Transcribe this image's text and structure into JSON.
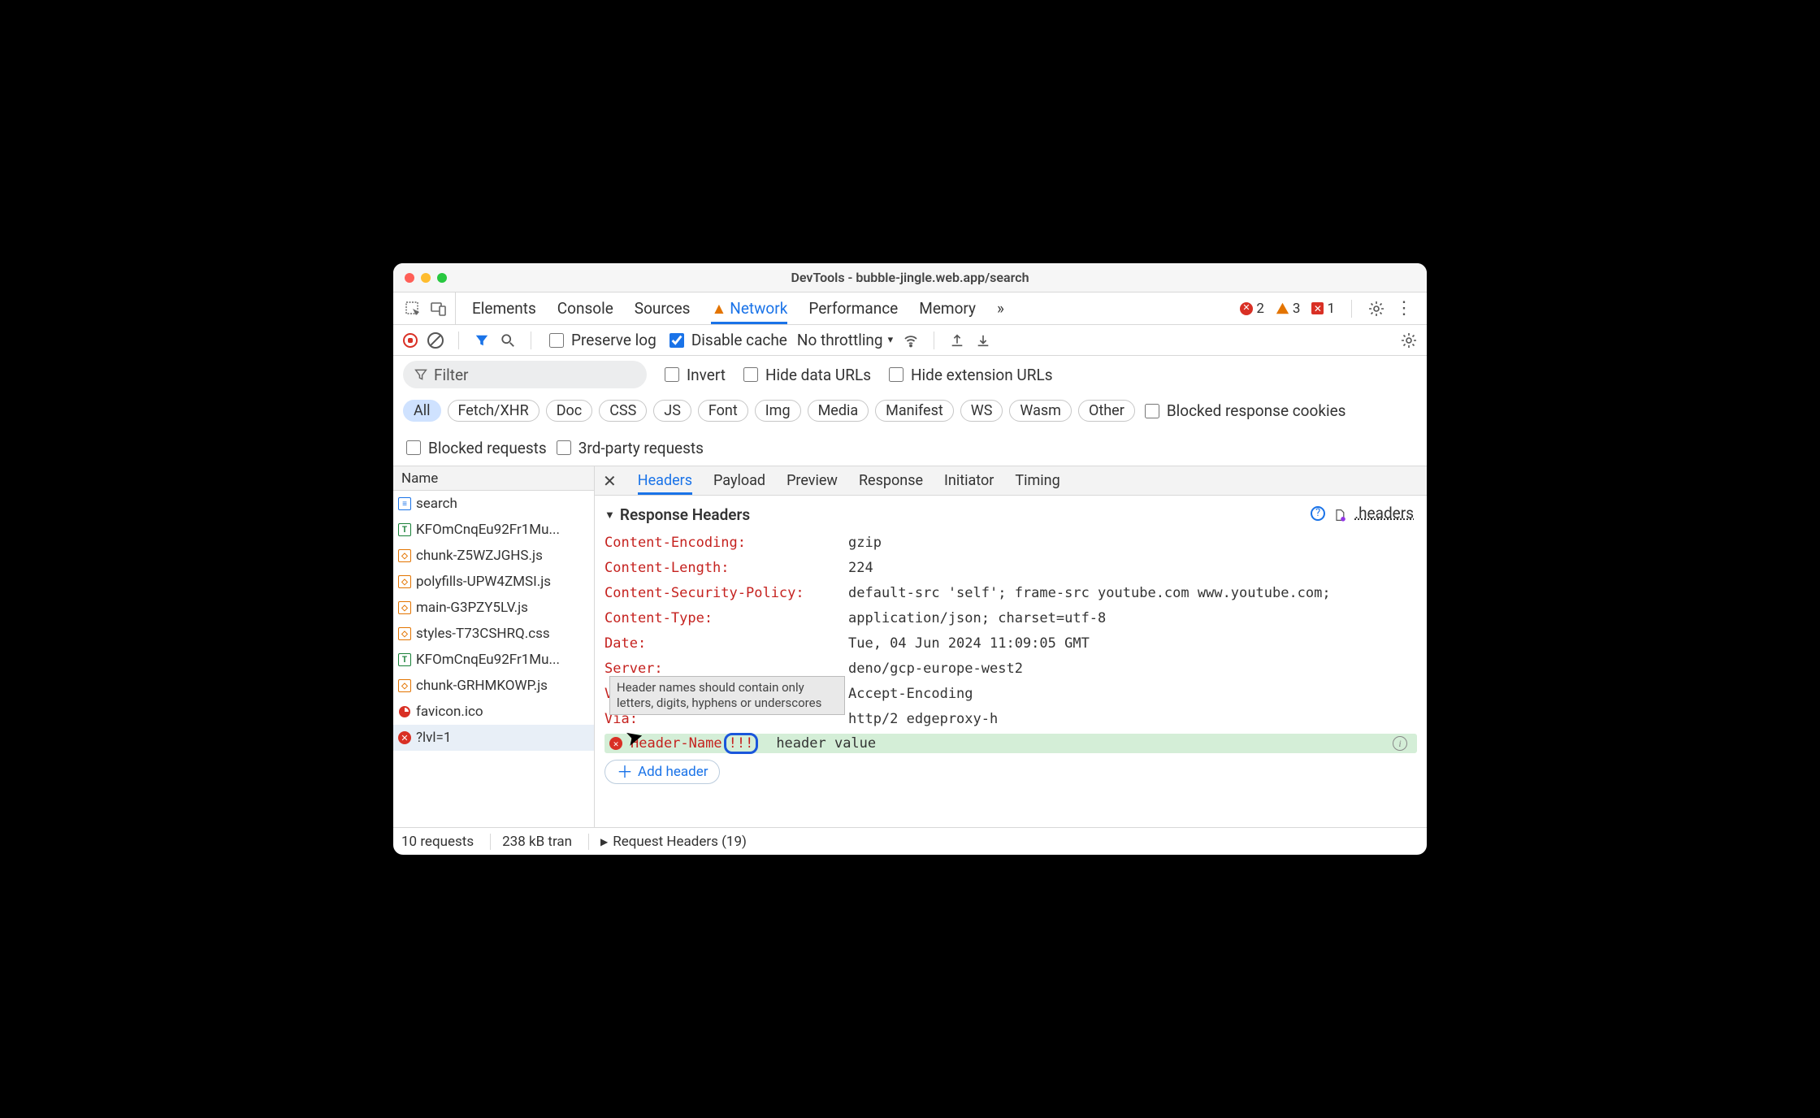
{
  "window": {
    "title": "DevTools - bubble-jingle.web.app/search"
  },
  "main_tabs": {
    "items": [
      "Elements",
      "Console",
      "Sources",
      "Network",
      "Performance",
      "Memory"
    ],
    "active": "Network",
    "more_glyph": "»",
    "status": {
      "errors": "2",
      "warnings": "3",
      "issues": "1"
    }
  },
  "toolbar": {
    "preserve_log": "Preserve log",
    "disable_cache": "Disable cache",
    "throttling": "No throttling"
  },
  "filters": {
    "placeholder": "Filter",
    "invert": "Invert",
    "hide_data": "Hide data URLs",
    "hide_ext": "Hide extension URLs",
    "types": [
      "All",
      "Fetch/XHR",
      "Doc",
      "CSS",
      "JS",
      "Font",
      "Img",
      "Media",
      "Manifest",
      "WS",
      "Wasm",
      "Other"
    ],
    "active_type": "All",
    "blocked_cookies": "Blocked response cookies",
    "blocked_requests": "Blocked requests",
    "third_party": "3rd-party requests"
  },
  "requests": {
    "col": "Name",
    "items": [
      {
        "name": "search",
        "type": "doc"
      },
      {
        "name": "KFOmCnqEu92Fr1Mu...",
        "type": "font"
      },
      {
        "name": "chunk-Z5WZJGHS.js",
        "type": "js"
      },
      {
        "name": "polyfills-UPW4ZMSI.js",
        "type": "js"
      },
      {
        "name": "main-G3PZY5LV.js",
        "type": "js"
      },
      {
        "name": "styles-T73CSHRQ.css",
        "type": "js"
      },
      {
        "name": "KFOmCnqEu92Fr1Mu...",
        "type": "font"
      },
      {
        "name": "chunk-GRHMKOWP.js",
        "type": "js"
      },
      {
        "name": "favicon.ico",
        "type": "ico"
      },
      {
        "name": "?lvl=1",
        "type": "err",
        "selected": true
      }
    ]
  },
  "detail_tabs": {
    "items": [
      "Headers",
      "Payload",
      "Preview",
      "Response",
      "Initiator",
      "Timing"
    ],
    "active": "Headers"
  },
  "response_headers": {
    "title": "Response Headers",
    "link": ".headers",
    "rows": [
      {
        "name": "Content-Encoding:",
        "value": "gzip"
      },
      {
        "name": "Content-Length:",
        "value": "224"
      },
      {
        "name": "Content-Security-Policy:",
        "value": "default-src 'self'; frame-src youtube.com www.youtube.com;"
      },
      {
        "name": "Content-Type:",
        "value": "application/json; charset=utf-8"
      },
      {
        "name": "Date:",
        "value": "Tue, 04 Jun 2024 11:09:05 GMT"
      },
      {
        "name": "Server:",
        "value": "deno/gcp-europe-west2"
      },
      {
        "name": "Vary:",
        "value": "Accept-Encoding"
      },
      {
        "name": "Via:",
        "value": "http/2 edgeproxy-h"
      }
    ],
    "new_header": {
      "name": "Header-Name",
      "bad": "!!!",
      "value": "header value"
    },
    "tooltip": "Header names should contain only letters, digits, hyphens or underscores",
    "add_button": "Add header"
  },
  "request_headers": {
    "title": "Request Headers (19)"
  },
  "footer": {
    "requests": "10 requests",
    "transfer": "238 kB tran"
  }
}
